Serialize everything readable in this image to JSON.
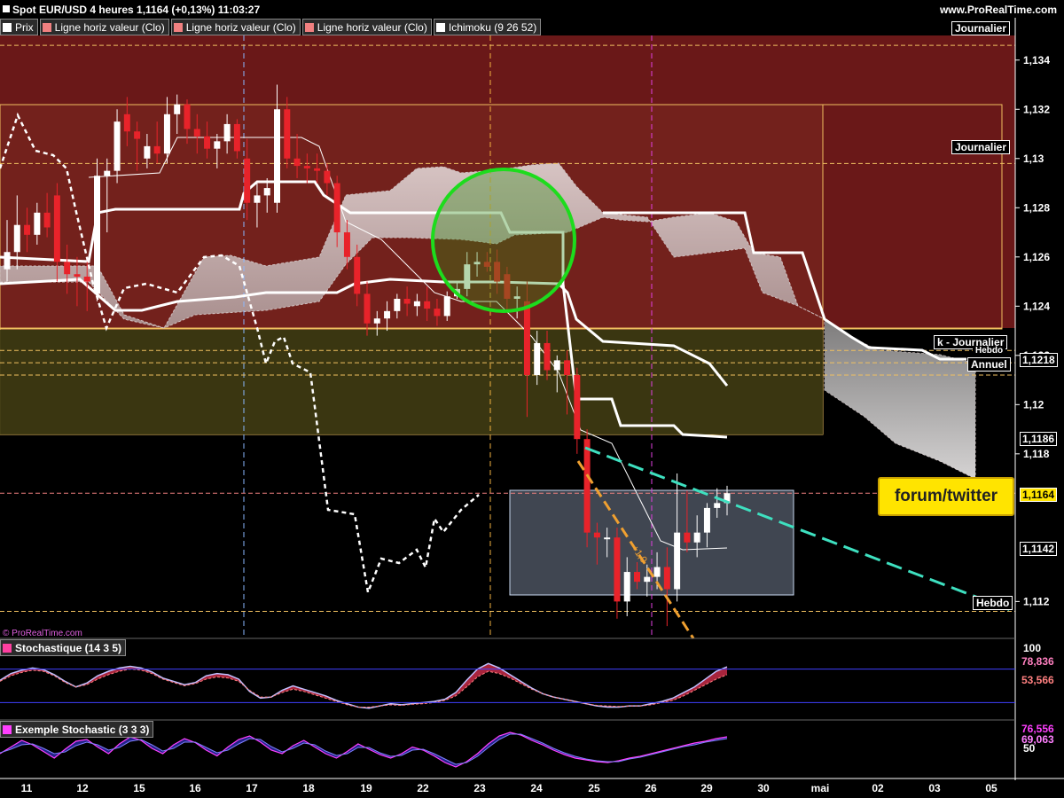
{
  "header": {
    "title": "Spot EUR/USD 4 heures 1,1164 (+0,13%) 11:03:27",
    "site": "www.ProRealTime.com",
    "copyright": "© ProRealTime.com"
  },
  "legend": [
    {
      "label": "Prix",
      "color": "#ffffff"
    },
    {
      "label": "Ligne horiz valeur (Clo)",
      "color": "#f08080"
    },
    {
      "label": "Ligne horiz valeur (Clo)",
      "color": "#f08080"
    },
    {
      "label": "Ligne horiz valeur (Clo)",
      "color": "#f08080"
    },
    {
      "label": "Ichimoku (9 26 52)",
      "color": "#ffffff"
    }
  ],
  "price_labels": {
    "journalier_top": "Journalier",
    "journalier_mid": "Journalier",
    "k_journalier": "k - Journalier",
    "hebdo_top": "Hebdo",
    "annuel": "Annuel",
    "hebdo_bottom": "Hebdo"
  },
  "annotation": {
    "forum": "forum/twitter",
    "fib": "+1,0"
  },
  "colors": {
    "bull": "#ffffff",
    "bear": "#e8232a",
    "zone_maroon": "#6a1818",
    "zone_olive": "#3a3a12",
    "trend": "#3ee0c0",
    "circle": "#1ddc1d",
    "orange": "#f0a030"
  },
  "chart_data": [
    {
      "type": "candlestick",
      "title": "Spot EUR/USD 4 heures",
      "ylim": [
        1.1105,
        1.135
      ],
      "y_ticks": [
        "1,134",
        "1,132",
        "1,13",
        "1,128",
        "1,126",
        "1,124",
        "1,122",
        "1,12",
        "1,118",
        "1,112"
      ],
      "price_tags": {
        "last": "1,1164",
        "annuel": "1,1218",
        "tenkan": "1,1186",
        "low": "1,1142",
        "last_val": 1.1164
      },
      "x_ticks": [
        "11",
        "12",
        "15",
        "16",
        "17",
        "18",
        "19",
        "22",
        "23",
        "24",
        "25",
        "26",
        "29",
        "30",
        "mai",
        "02",
        "03",
        "05"
      ],
      "ohlc": [
        [
          1.1255,
          1.1275,
          1.125,
          1.1262
        ],
        [
          1.1262,
          1.1285,
          1.1255,
          1.1273
        ],
        [
          1.1273,
          1.128,
          1.1262,
          1.1269
        ],
        [
          1.1269,
          1.1282,
          1.1265,
          1.1278
        ],
        [
          1.1278,
          1.1286,
          1.1268,
          1.1272
        ],
        [
          1.1285,
          1.129,
          1.125,
          1.1258
        ],
        [
          1.1258,
          1.1265,
          1.1245,
          1.1253
        ],
        [
          1.1253,
          1.126,
          1.124,
          1.1252
        ],
        [
          1.1252,
          1.1258,
          1.1238,
          1.125
        ],
        [
          1.1245,
          1.13,
          1.1242,
          1.1293
        ],
        [
          1.1293,
          1.13,
          1.127,
          1.1295
        ],
        [
          1.1295,
          1.132,
          1.129,
          1.1315
        ],
        [
          1.1318,
          1.1325,
          1.1305,
          1.1311
        ],
        [
          1.1311,
          1.1315,
          1.1295,
          1.1308
        ],
        [
          1.13,
          1.131,
          1.1296,
          1.1305
        ],
        [
          1.1305,
          1.1315,
          1.1298,
          1.1302
        ],
        [
          1.1302,
          1.1325,
          1.1298,
          1.1318
        ],
        [
          1.1318,
          1.1326,
          1.131,
          1.1322
        ],
        [
          1.1322,
          1.1324,
          1.1306,
          1.1312
        ],
        [
          1.1312,
          1.1318,
          1.1302,
          1.1309
        ],
        [
          1.1309,
          1.1315,
          1.13,
          1.1304
        ],
        [
          1.1304,
          1.131,
          1.1296,
          1.1307
        ],
        [
          1.1307,
          1.1318,
          1.1302,
          1.1314
        ],
        [
          1.1314,
          1.1316,
          1.13,
          1.1303
        ],
        [
          1.13,
          1.1308,
          1.1275,
          1.1282
        ],
        [
          1.1282,
          1.129,
          1.1272,
          1.1285
        ],
        [
          1.1285,
          1.1292,
          1.1278,
          1.1288
        ],
        [
          1.1282,
          1.133,
          1.1278,
          1.132
        ],
        [
          1.132,
          1.1325,
          1.1296,
          1.13
        ],
        [
          1.13,
          1.131,
          1.1292,
          1.1297
        ],
        [
          1.1297,
          1.1302,
          1.129,
          1.1296
        ],
        [
          1.1296,
          1.1302,
          1.129,
          1.1295
        ],
        [
          1.1295,
          1.1298,
          1.1285,
          1.129
        ],
        [
          1.129,
          1.1293,
          1.1264,
          1.127
        ],
        [
          1.127,
          1.1275,
          1.1255,
          1.126
        ],
        [
          1.126,
          1.1265,
          1.124,
          1.1245
        ],
        [
          1.1245,
          1.125,
          1.1228,
          1.1233
        ],
        [
          1.1233,
          1.1238,
          1.1228,
          1.1235
        ],
        [
          1.1235,
          1.1242,
          1.123,
          1.1238
        ],
        [
          1.1238,
          1.1245,
          1.1235,
          1.1243
        ],
        [
          1.1243,
          1.1248,
          1.1236,
          1.1241
        ],
        [
          1.124,
          1.1245,
          1.1236,
          1.1242
        ],
        [
          1.1242,
          1.1248,
          1.1234,
          1.1239
        ],
        [
          1.1239,
          1.1243,
          1.1232,
          1.1236
        ],
        [
          1.1236,
          1.1246,
          1.1234,
          1.1244
        ],
        [
          1.1244,
          1.125,
          1.1243,
          1.1247
        ],
        [
          1.1247,
          1.1262,
          1.1244,
          1.1257
        ],
        [
          1.1257,
          1.1262,
          1.1252,
          1.1258
        ],
        [
          1.1258,
          1.1262,
          1.1254,
          1.1256
        ],
        [
          1.1258,
          1.1263,
          1.1245,
          1.125
        ],
        [
          1.1253,
          1.1256,
          1.1238,
          1.1243
        ],
        [
          1.1243,
          1.1248,
          1.1235,
          1.1244
        ],
        [
          1.1242,
          1.125,
          1.1195,
          1.1212
        ],
        [
          1.1212,
          1.123,
          1.1208,
          1.1225
        ],
        [
          1.1225,
          1.123,
          1.121,
          1.1214
        ],
        [
          1.1214,
          1.122,
          1.1205,
          1.1218
        ],
        [
          1.1218,
          1.1222,
          1.1196,
          1.1212
        ],
        [
          1.1212,
          1.1215,
          1.118,
          1.1186
        ],
        [
          1.1186,
          1.119,
          1.1142,
          1.1148
        ],
        [
          1.1148,
          1.1152,
          1.1135,
          1.1146
        ],
        [
          1.1146,
          1.115,
          1.1138,
          1.1146
        ],
        [
          1.1146,
          1.115,
          1.1113,
          1.112
        ],
        [
          1.112,
          1.1138,
          1.1114,
          1.1132
        ],
        [
          1.1132,
          1.1136,
          1.1125,
          1.1128
        ],
        [
          1.1128,
          1.1135,
          1.1122,
          1.113
        ],
        [
          1.113,
          1.114,
          1.1125,
          1.1134
        ],
        [
          1.1134,
          1.1142,
          1.111,
          1.1125
        ],
        [
          1.1125,
          1.1172,
          1.112,
          1.1148
        ],
        [
          1.1148,
          1.1165,
          1.114,
          1.1144
        ],
        [
          1.1144,
          1.1155,
          1.1138,
          1.1148
        ],
        [
          1.1148,
          1.116,
          1.1142,
          1.1158
        ],
        [
          1.1158,
          1.1166,
          1.1154,
          1.116
        ],
        [
          1.116,
          1.1167,
          1.1155,
          1.1164
        ]
      ]
    },
    {
      "type": "area",
      "title": "Stochastique (14 3 5)",
      "ylim": [
        0,
        100
      ],
      "labels": [
        "78,836",
        "53,566"
      ],
      "y_top_label": "100",
      "k": [
        60,
        72,
        78,
        82,
        79,
        70,
        58,
        48,
        55,
        68,
        76,
        82,
        85,
        82,
        75,
        64,
        58,
        52,
        56,
        68,
        72,
        70,
        62,
        40,
        28,
        30,
        42,
        50,
        44,
        38,
        32,
        24,
        18,
        12,
        10,
        14,
        18,
        16,
        18,
        20,
        22,
        26,
        38,
        60,
        80,
        90,
        82,
        70,
        58,
        46,
        36,
        30,
        26,
        22,
        18,
        14,
        12,
        12,
        14,
        14,
        18,
        22,
        28,
        38,
        48,
        62,
        76,
        84
      ],
      "d": [
        58,
        68,
        74,
        78,
        76,
        68,
        56,
        48,
        52,
        62,
        70,
        76,
        80,
        78,
        72,
        62,
        56,
        50,
        54,
        62,
        66,
        64,
        58,
        42,
        30,
        30,
        38,
        44,
        40,
        34,
        28,
        22,
        16,
        12,
        12,
        14,
        16,
        15,
        17,
        18,
        20,
        24,
        32,
        48,
        66,
        76,
        72,
        64,
        54,
        44,
        36,
        30,
        26,
        22,
        18,
        15,
        14,
        13,
        14,
        14,
        16,
        20,
        24,
        32,
        42,
        52,
        62,
        70
      ]
    },
    {
      "type": "line",
      "title": "Exemple Stochastic (3 3 3)",
      "ylim": [
        0,
        100
      ],
      "labels": [
        "76,556",
        "69,063",
        "50"
      ],
      "k": [
        40,
        55,
        70,
        60,
        45,
        30,
        50,
        68,
        72,
        55,
        40,
        62,
        78,
        70,
        52,
        40,
        60,
        74,
        65,
        48,
        35,
        55,
        72,
        80,
        66,
        48,
        40,
        58,
        70,
        55,
        40,
        30,
        45,
        62,
        50,
        38,
        30,
        40,
        55,
        48,
        35,
        20,
        10,
        22,
        40,
        62,
        80,
        88,
        82,
        70,
        60,
        48,
        38,
        30,
        26,
        22,
        20,
        24,
        30,
        34,
        40,
        46,
        52,
        58,
        64,
        68,
        74,
        78
      ],
      "d": [
        42,
        50,
        60,
        62,
        52,
        40,
        44,
        58,
        66,
        60,
        48,
        54,
        68,
        72,
        60,
        46,
        52,
        66,
        66,
        54,
        42,
        48,
        62,
        74,
        72,
        56,
        44,
        52,
        64,
        60,
        46,
        36,
        40,
        54,
        54,
        42,
        34,
        36,
        48,
        50,
        40,
        28,
        16,
        20,
        34,
        54,
        72,
        84,
        84,
        74,
        64,
        52,
        42,
        34,
        28,
        24,
        22,
        22,
        28,
        32,
        38,
        44,
        50,
        56,
        60,
        66,
        70,
        74
      ]
    }
  ]
}
